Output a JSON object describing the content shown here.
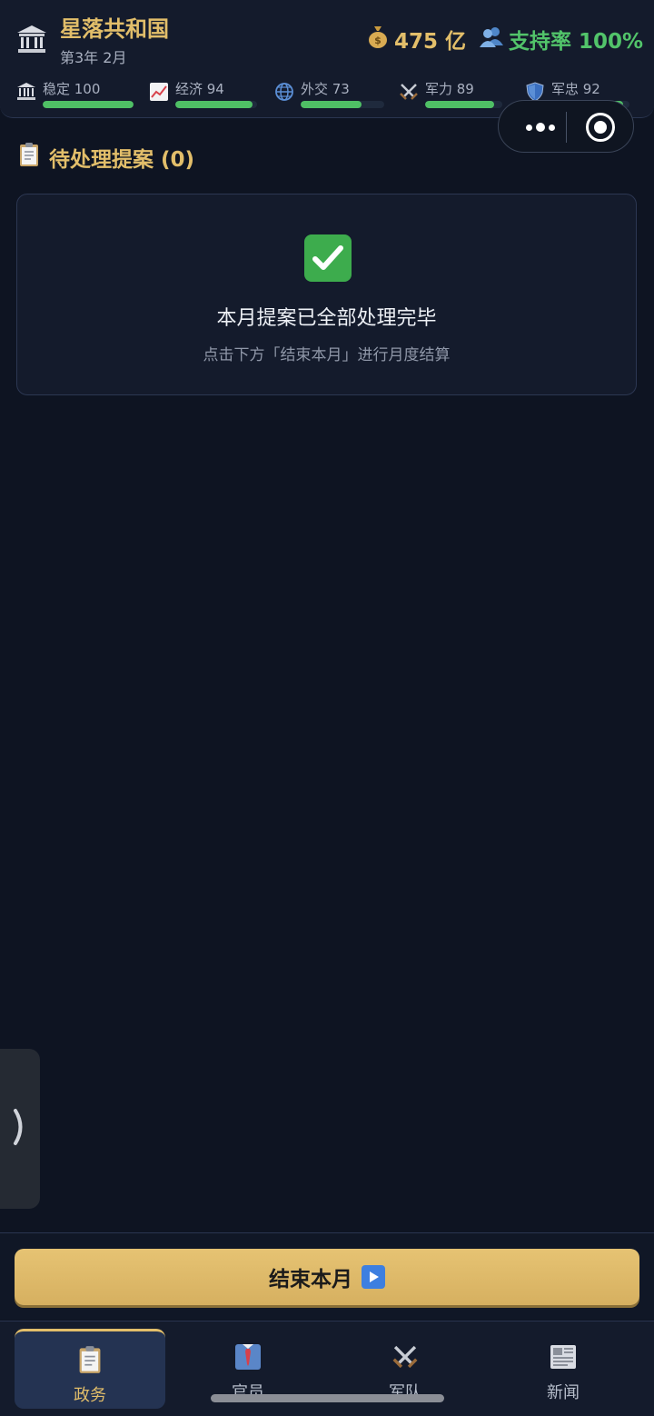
{
  "header": {
    "nation_name": "星落共和国",
    "date": "第3年 2月",
    "money": "475 亿",
    "support": "支持率 100%"
  },
  "stats": [
    {
      "label": "稳定 100",
      "value": 100,
      "icon": "stability-icon"
    },
    {
      "label": "经济 94",
      "value": 94,
      "icon": "economy-chart-icon"
    },
    {
      "label": "外交 73",
      "value": 73,
      "icon": "globe-icon"
    },
    {
      "label": "军力 89",
      "value": 89,
      "icon": "crossed-swords-icon"
    },
    {
      "label": "军忠 92",
      "value": 92,
      "icon": "shield-icon"
    }
  ],
  "proposals": {
    "title": "待处理提案 (0)",
    "empty_title": "本月提案已全部处理完毕",
    "empty_hint": "点击下方「结束本月」进行月度结算"
  },
  "actions": {
    "end_month": "结束本月"
  },
  "tabs": [
    {
      "label": "政务",
      "icon": "clipboard-icon",
      "active": true
    },
    {
      "label": "官员",
      "icon": "official-tie-icon",
      "active": false
    },
    {
      "label": "军队",
      "icon": "crossed-swords-icon",
      "active": false
    },
    {
      "label": "新闻",
      "icon": "newspaper-icon",
      "active": false
    }
  ],
  "colors": {
    "accent_gold": "#e2be6a",
    "positive_green": "#4fc065",
    "background": "#0e1422"
  }
}
